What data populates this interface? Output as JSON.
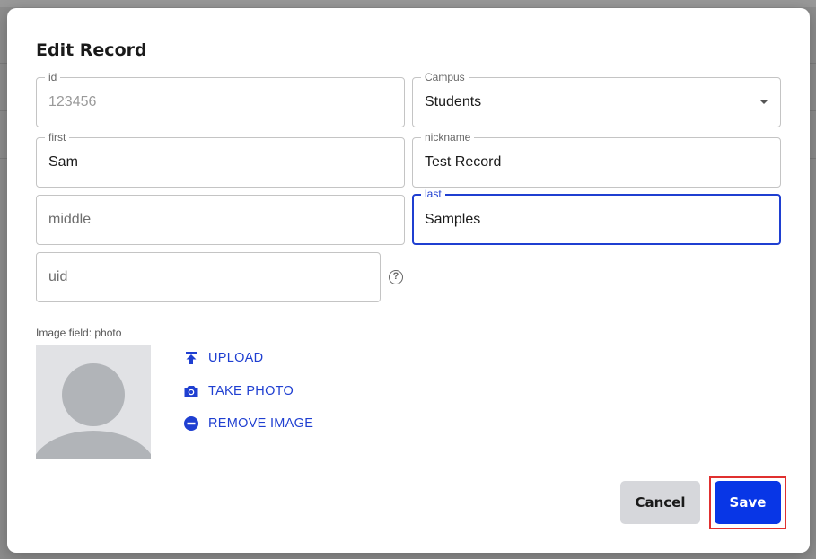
{
  "dialog": {
    "title": "Edit Record"
  },
  "fields": {
    "id": {
      "label": "id",
      "value": "123456"
    },
    "campus": {
      "label": "Campus",
      "value": "Students"
    },
    "first": {
      "label": "first",
      "value": "Sam"
    },
    "nickname": {
      "label": "nickname",
      "value": "Test Record"
    },
    "middle": {
      "placeholder": "middle"
    },
    "last": {
      "label": "last",
      "value": "Samples"
    },
    "uid": {
      "placeholder": "uid"
    }
  },
  "image_field": {
    "caption": "Image field: photo",
    "actions": {
      "upload": "UPLOAD",
      "take_photo": "TAKE PHOTO",
      "remove_image": "REMOVE IMAGE"
    }
  },
  "buttons": {
    "cancel": "Cancel",
    "save": "Save"
  },
  "colors": {
    "accent": "#1f3fd1",
    "save_button": "#0836e6",
    "highlight": "#e0302f"
  },
  "icons": {
    "help": "?",
    "upload": "upload-icon",
    "camera": "camera-icon",
    "remove": "remove-circle-icon",
    "dropdown": "chevron-down-icon"
  }
}
